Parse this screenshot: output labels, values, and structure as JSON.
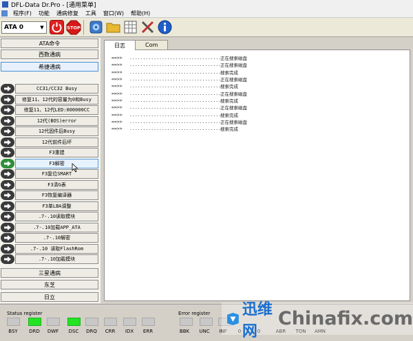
{
  "window": {
    "title": "DFL-Data Dr.Pro - [通用菜单]"
  },
  "menu": {
    "items": [
      {
        "label": "程序(F)"
      },
      {
        "label": "功能"
      },
      {
        "label": "通病修复"
      },
      {
        "label": "工具"
      },
      {
        "label": "窗口(W)"
      },
      {
        "label": "帮助(H)"
      }
    ]
  },
  "toolbar": {
    "port_selected": "ATA 0",
    "stop_label": "STOP",
    "icons": [
      "power-icon",
      "stop-icon",
      "drive-icon",
      "folder-icon",
      "grid-icon",
      "tools-icon",
      "info-icon"
    ]
  },
  "left_panel": {
    "top_buttons": [
      {
        "label": "ATA命令"
      },
      {
        "label": "西数通病"
      },
      {
        "label": "希捷通病",
        "selected": true
      }
    ],
    "commands": [
      {
        "label": "CC31/CC32 Busy"
      },
      {
        "label": "修复11、12代的容量为0和Busy"
      },
      {
        "label": "修复11、12代LED:000000CC"
      },
      {
        "label": "12代(BOS)error"
      },
      {
        "label": "12代固件后Busy"
      },
      {
        "label": "12代前件后坏"
      },
      {
        "label": "F3重建"
      },
      {
        "label": "F3解密",
        "active": true
      },
      {
        "label": "F3复位SMART"
      },
      {
        "label": "F3清G表"
      },
      {
        "label": "F3恢复编译器"
      },
      {
        "label": "F3单LBA调整"
      },
      {
        "label": ".7-.10读取模块"
      },
      {
        "label": ".7-.10加载APP_ATA"
      },
      {
        "label": ".7-.10解密"
      },
      {
        "label": ".7-.10 读取FlashRom"
      },
      {
        "label": ".7-.10加载模块"
      }
    ],
    "bottom_buttons": [
      {
        "label": "三星通病"
      },
      {
        "label": "东芝"
      },
      {
        "label": "日立"
      }
    ]
  },
  "log_panel": {
    "tabs": [
      {
        "label": "日志",
        "active": true
      },
      {
        "label": "Com"
      }
    ],
    "lines": [
      {
        "prompt": "==>>",
        "dots": "..................................................",
        "message": "正在搜索磁盘"
      },
      {
        "prompt": "==>>",
        "dots": "..................................................",
        "message": "正在搜索磁盘"
      },
      {
        "prompt": "==>>",
        "dots": "..................................................",
        "message": "搜索完成"
      },
      {
        "prompt": "==>>",
        "dots": "..................................................",
        "message": "正在搜索磁盘"
      },
      {
        "prompt": "==>>",
        "dots": "..................................................",
        "message": "搜索完成"
      },
      {
        "prompt": "==>>",
        "dots": "..................................................",
        "message": "正在搜索磁盘"
      },
      {
        "prompt": "==>>",
        "dots": "..................................................",
        "message": "搜索完成"
      },
      {
        "prompt": "==>>",
        "dots": "..................................................",
        "message": "正在搜索磁盘"
      },
      {
        "prompt": "==>>",
        "dots": "..................................................",
        "message": "搜索完成"
      },
      {
        "prompt": "==>>",
        "dots": "..................................................",
        "message": "正在搜索磁盘"
      },
      {
        "prompt": "==>>",
        "dots": "..................................................",
        "message": "搜索完成"
      }
    ]
  },
  "status_register": {
    "title": "Status register",
    "bits": [
      {
        "label": "BSY",
        "on": false
      },
      {
        "label": "DRD",
        "on": true
      },
      {
        "label": "DWF",
        "on": false
      },
      {
        "label": "DSC",
        "on": true
      },
      {
        "label": "DRQ",
        "on": false
      },
      {
        "label": "CRR",
        "on": false
      },
      {
        "label": "IDX",
        "on": false
      },
      {
        "label": "ERR",
        "on": false
      }
    ]
  },
  "error_register": {
    "title": "Error register",
    "bits": [
      {
        "label": "BBK",
        "on": false
      },
      {
        "label": "UNC",
        "on": false
      },
      {
        "label": "INF",
        "on": false
      },
      {
        "label": "0",
        "on": false
      },
      {
        "label": "0",
        "on": false
      },
      {
        "label": "ABR",
        "on": false
      },
      {
        "label": "TON",
        "on": false
      },
      {
        "label": "AMN",
        "on": false
      }
    ]
  },
  "watermark": {
    "text_cn": "迅维网",
    "text_en": "Chinafix.com"
  },
  "colors": {
    "led_on": "#23e323",
    "led_off": "#c8c8c8",
    "selected_border": "#4a8fd6",
    "active_arrow": "#2f8f3a"
  }
}
